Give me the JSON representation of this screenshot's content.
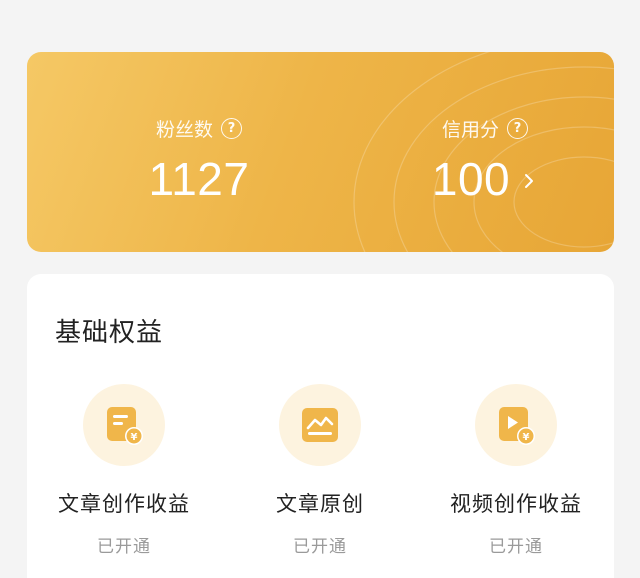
{
  "stats": {
    "fans": {
      "label": "粉丝数",
      "value": "1127",
      "help_icon": "question-circle-icon"
    },
    "credit": {
      "label": "信用分",
      "value": "100",
      "help_icon": "question-circle-icon",
      "arrow_icon": "chevron-right-icon"
    }
  },
  "rights": {
    "title": "基础权益",
    "items": [
      {
        "label": "文章创作收益",
        "status": "已开通",
        "icon": "article-income-icon"
      },
      {
        "label": "文章原创",
        "status": "已开通",
        "icon": "article-original-icon"
      },
      {
        "label": "视频创作收益",
        "status": "已开通",
        "icon": "video-income-icon"
      }
    ]
  },
  "colors": {
    "card_gradient_start": "#f5c865",
    "card_gradient_end": "#e7a636",
    "icon_bg": "#fdf3df",
    "icon_fill": "#f0b64a",
    "status_text": "#9a9a9a"
  }
}
